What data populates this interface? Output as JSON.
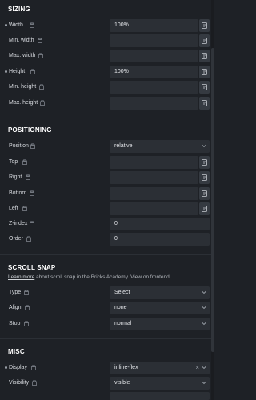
{
  "sizing": {
    "title": "SIZING",
    "rows": [
      {
        "label": "Width",
        "value": "100%"
      },
      {
        "label": "Min. width",
        "value": ""
      },
      {
        "label": "Max. width",
        "value": ""
      },
      {
        "label": "Height",
        "value": "100%"
      },
      {
        "label": "Min. height",
        "value": ""
      },
      {
        "label": "Max. height",
        "value": ""
      }
    ]
  },
  "positioning": {
    "title": "POSITIONING",
    "position": {
      "label": "Position",
      "value": "relative"
    },
    "rows": [
      {
        "label": "Top",
        "value": ""
      },
      {
        "label": "Right",
        "value": ""
      },
      {
        "label": "Bottom",
        "value": ""
      },
      {
        "label": "Left",
        "value": ""
      }
    ],
    "zindex": {
      "label": "Z-index",
      "value": "0"
    },
    "order": {
      "label": "Order",
      "value": "0"
    }
  },
  "scroll_snap": {
    "title": "SCROLL SNAP",
    "learn_more": "Learn more",
    "academy_text": " about scroll snap in the Bricks Academy. View on frontend.",
    "type": {
      "label": "Type",
      "value": "Select"
    },
    "align": {
      "label": "Align",
      "value": "none"
    },
    "stop": {
      "label": "Stop",
      "value": "normal"
    }
  },
  "misc": {
    "title": "MISC",
    "display": {
      "label": "Display",
      "value": "inline-flex",
      "clear": "×"
    },
    "visibility": {
      "label": "Visibility",
      "value": "visible"
    }
  },
  "colors": {
    "background": "#1e2126",
    "field": "#2b2f35",
    "text": "#e4e6ea"
  }
}
